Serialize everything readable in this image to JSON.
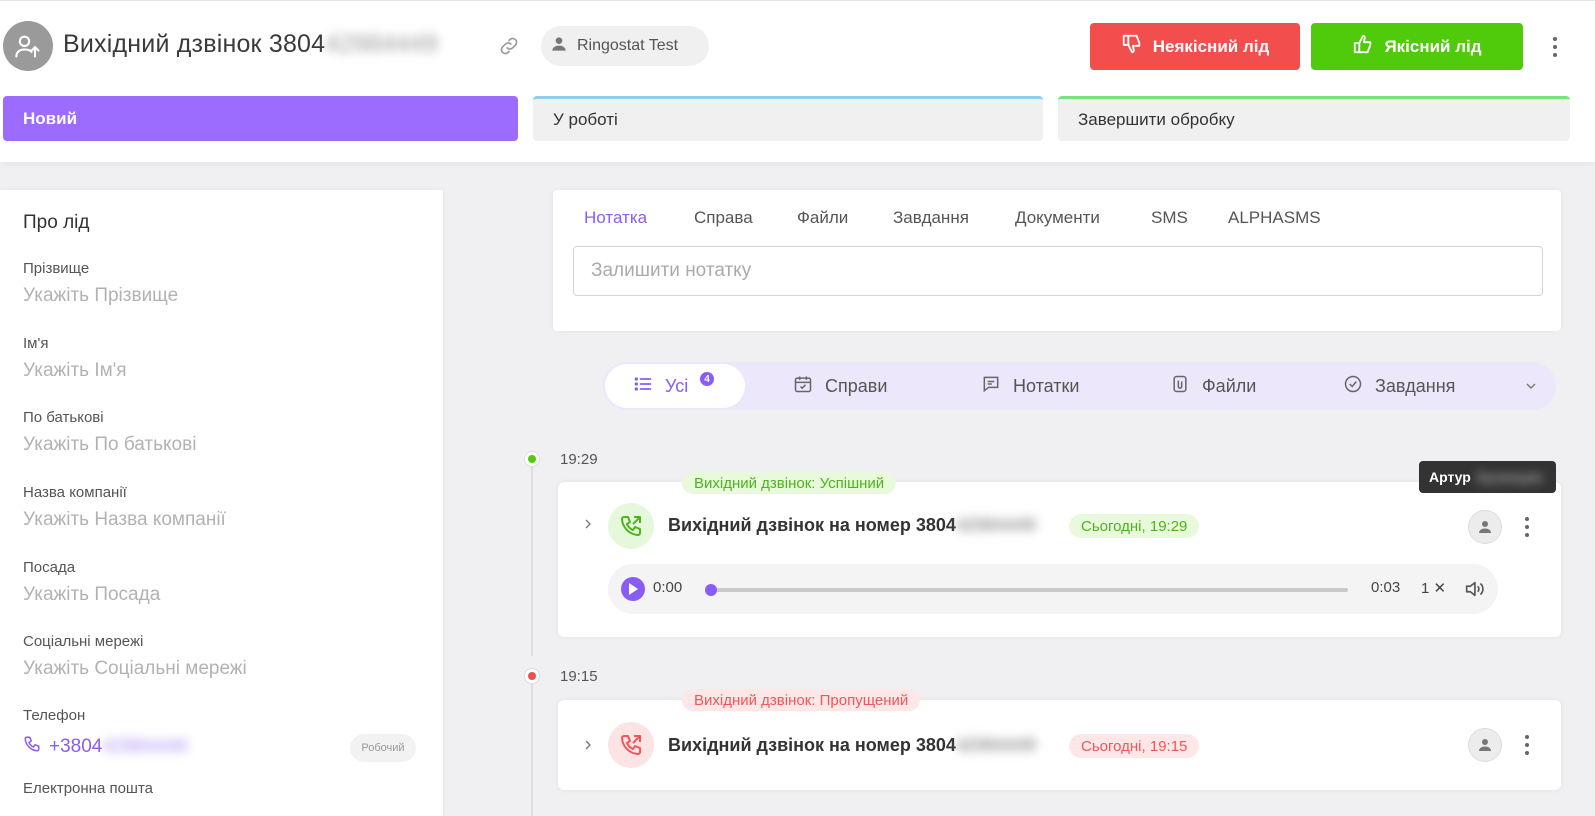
{
  "header": {
    "title": "Вихідний дзвінок 3804",
    "title_hidden": "42984449",
    "user_chip": "Ringostat Test",
    "bad_lead_label": "Неякісний лід",
    "good_lead_label": "Якісний лід"
  },
  "stages": {
    "new": "Новий",
    "in_work": "У роботі",
    "finish": "Завершити обробку"
  },
  "about": {
    "heading": "Про лід",
    "fields": [
      {
        "label": "Прізвище",
        "placeholder": "Укажіть Прізвище"
      },
      {
        "label": "Ім'я",
        "placeholder": "Укажіть Ім'я"
      },
      {
        "label": "По батькові",
        "placeholder": "Укажіть По батькові"
      },
      {
        "label": "Назва компанії",
        "placeholder": "Укажіть Назва компанії"
      },
      {
        "label": "Посада",
        "placeholder": "Укажіть Посада"
      },
      {
        "label": "Соціальні мережі",
        "placeholder": "Укажіть Соціальні мережі"
      }
    ],
    "phone_label": "Телефон",
    "phone_value": "+3804",
    "phone_hidden": "42984449",
    "phone_type": "Робочий",
    "email_label": "Електронна пошта"
  },
  "note_tabs": [
    "Нотатка",
    "Справа",
    "Файли",
    "Завдання",
    "Документи",
    "SMS",
    "ALPHASMS"
  ],
  "note_placeholder": "Залишити нотатку",
  "filters": {
    "all": "Усі",
    "all_count": "4",
    "deals": "Справи",
    "notes": "Нотатки",
    "files": "Файли",
    "tasks": "Завдання"
  },
  "timeline": [
    {
      "time": "19:29",
      "status": "Вихідний дзвінок: Успішний",
      "title": "Вихідний дзвінок на номер 3804",
      "title_hidden": "42984449",
      "date": "Сьогодні, 19:29",
      "player": {
        "current": "0:00",
        "duration": "0:03",
        "speed": "1"
      }
    },
    {
      "time": "19:15",
      "status": "Вихідний дзвінок: Пропущений",
      "title": "Вихідний дзвінок на номер 3804",
      "title_hidden": "42984449",
      "date": "Сьогодні, 19:15"
    }
  ],
  "tooltip": {
    "name": "Артур",
    "hidden": "Кузнецов"
  },
  "colors": {
    "accent": "#8a5cf6",
    "success": "#4fcb0c",
    "danger": "#f24e4e"
  }
}
